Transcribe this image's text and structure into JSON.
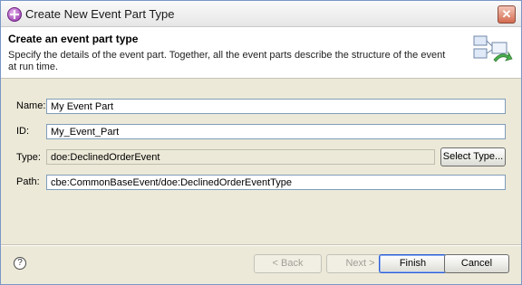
{
  "window": {
    "title": "Create New Event Part Type",
    "close_glyph": "✕",
    "app_icon": "event-part-icon"
  },
  "banner": {
    "title": "Create an event part type",
    "description": "Specify the details of the event part.  Together, all the event parts describe the structure of the event at run time.",
    "graphic_icon": "wizard-banner-icon"
  },
  "form": {
    "name_label": "Name:",
    "name_value": "My Event Part",
    "id_label": "ID:",
    "id_value": "My_Event_Part",
    "type_label": "Type:",
    "type_value": "doe:DeclinedOrderEvent",
    "select_type_label": "Select Type...",
    "path_label": "Path:",
    "path_value": "cbe:CommonBaseEvent/doe:DeclinedOrderEventType"
  },
  "footer": {
    "help_glyph": "?",
    "back_label": "< Back",
    "next_label": "Next >",
    "finish_label": "Finish",
    "cancel_label": "Cancel"
  },
  "colors": {
    "dialog_bg": "#ece9d8",
    "banner_bg": "#ffffff",
    "input_border": "#7f9db9",
    "focus_border": "#2a5bd6"
  }
}
